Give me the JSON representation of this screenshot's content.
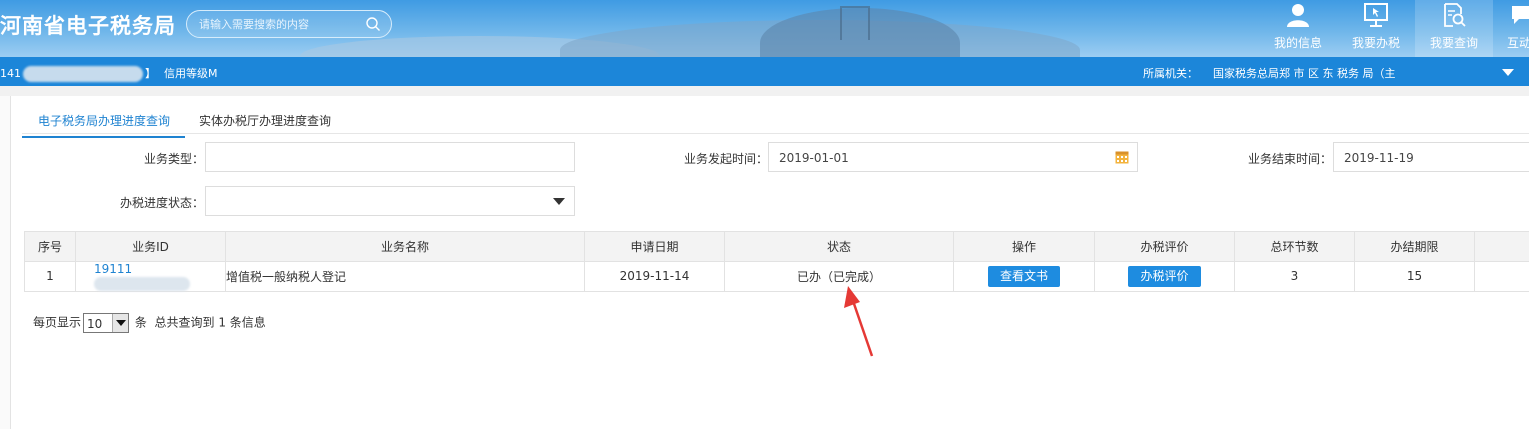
{
  "header": {
    "title": "河南省电子税务局",
    "search": {
      "placeholder": "请输入需要搜索的内容"
    },
    "nav": [
      {
        "label": "我的信息",
        "icon": "user-icon"
      },
      {
        "label": "我要办税",
        "icon": "monitor-icon"
      },
      {
        "label": "我要查询",
        "icon": "document-search-icon",
        "active": true
      },
      {
        "label": "互动",
        "icon": "chat-icon"
      }
    ]
  },
  "subbar": {
    "account_prefix": "141",
    "account_suffix": "】",
    "credit": "信用等级M",
    "org_label": "所属机关：",
    "org_value": "国家税务总局郑  市    区  东  税务  局（主"
  },
  "tabs": [
    {
      "label": "电子税务局办理进度查询",
      "active": true
    },
    {
      "label": "实体办税厅办理进度查询",
      "active": false
    }
  ],
  "form": {
    "business_type_label": "业务类型：",
    "business_type_value": "",
    "start_time_label": "业务发起时间：",
    "start_time_value": "2019-01-01",
    "end_time_label": "业务结束时间：",
    "end_time_value": "2019-11-19",
    "progress_status_label": "办税进度状态：",
    "progress_status_value": ""
  },
  "table": {
    "headers": [
      "序号",
      "业务ID",
      "业务名称",
      "申请日期",
      "状态",
      "操作",
      "办税评价",
      "总环节数",
      "办结期限",
      ""
    ],
    "rows": [
      {
        "index": "1",
        "id_prefix": "19111",
        "name": "增值税一般纳税人登记",
        "date": "2019-11-14",
        "status": "已办（已完成）",
        "action": "查看文书",
        "evaluate": "办税评价",
        "steps": "3",
        "deadline": "15"
      }
    ]
  },
  "pager": {
    "per_page_label": "每页显示",
    "per_page_value": "10",
    "unit": "条",
    "summary": "总共查询到 1 条信息"
  },
  "colors": {
    "header_blue": "#3f9be3",
    "subbar_blue": "#1c86d9",
    "accent": "#1f83d1",
    "success_green": "#2f9e44",
    "annotation_red": "#e53935"
  }
}
